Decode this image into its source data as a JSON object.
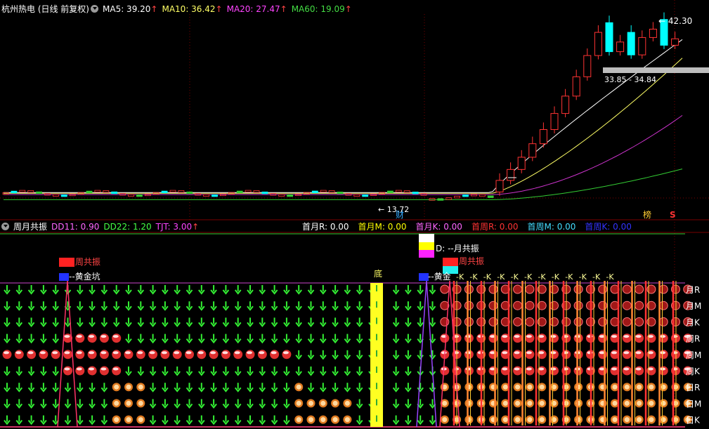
{
  "main_panel": {
    "title": "杭州热电 (日线 前复权)",
    "ma_readouts": [
      {
        "label": "MA5: 39.20",
        "arrow": "↑",
        "color": "#ffffff"
      },
      {
        "label": "MA10: 36.42",
        "arrow": "↑",
        "color": "#ffff66"
      },
      {
        "label": "MA20: 27.47",
        "arrow": "↑",
        "color": "#ff44ff"
      },
      {
        "label": "MA60: 19.09",
        "arrow": "↑",
        "color": "#44dd44"
      }
    ],
    "high_label": "42.30",
    "low_label": "13.72",
    "range_label": "33.85 - 34.84",
    "marker_cai": "财",
    "marker_bang": "榜",
    "marker_s": "S"
  },
  "indicator_panel": {
    "title": "周月共振",
    "readouts_left": [
      {
        "label": "DD11: 0.90",
        "color": "#ff66ff"
      },
      {
        "label": "DD22: 1.20",
        "color": "#44ff44"
      },
      {
        "label": "TJT: 3.00",
        "color": "#ff44ff",
        "arrow": "↑"
      }
    ],
    "readouts_right": [
      {
        "label": "首月R: 0.00",
        "color": "#ffffff"
      },
      {
        "label": "首月M: 0.00",
        "color": "#ffff00"
      },
      {
        "label": "首月K: 0.00",
        "color": "#ff66ff"
      },
      {
        "label": "首周R: 0.00",
        "color": "#ff3333"
      },
      {
        "label": "首周M: 0.00",
        "color": "#44ddff"
      },
      {
        "label": "首周K: 0.00",
        "color": "#3333ff"
      }
    ],
    "row_labels": [
      "月R",
      "月M",
      "月K",
      "周R",
      "周M",
      "周K",
      "日R",
      "日M",
      "日K"
    ],
    "label_zhou_gongzhen": "周共振",
    "label_huangjinkeng": "--黄金坑",
    "label_yue_gongzhen": "D: --月共振",
    "label_di": "底",
    "label_huangjin_suffix": "黄金",
    "ke_tag": "-K"
  },
  "chart_data": {
    "type": "candlestick",
    "title": "杭州热电 (日线 前复权)",
    "high": 42.3,
    "low": 13.72,
    "range_text": "33.85 - 34.84",
    "ma": {
      "MA5": 39.2,
      "MA10": 36.42,
      "MA20": 27.47,
      "MA60": 19.09
    },
    "recent_closes": [
      17.0,
      18.7,
      20.6,
      22.7,
      24.9,
      27.4,
      30.1,
      33.1,
      36.4,
      40.0,
      37.0,
      38.5,
      36.5,
      39.2,
      40.5,
      38.0,
      39.0
    ],
    "colors": {
      "up": "#ff3333",
      "down": "#00ffff",
      "ma5": "#ffffff",
      "ma10": "#ffff66",
      "ma20": "#cc33cc",
      "ma60": "#33cc33"
    }
  }
}
